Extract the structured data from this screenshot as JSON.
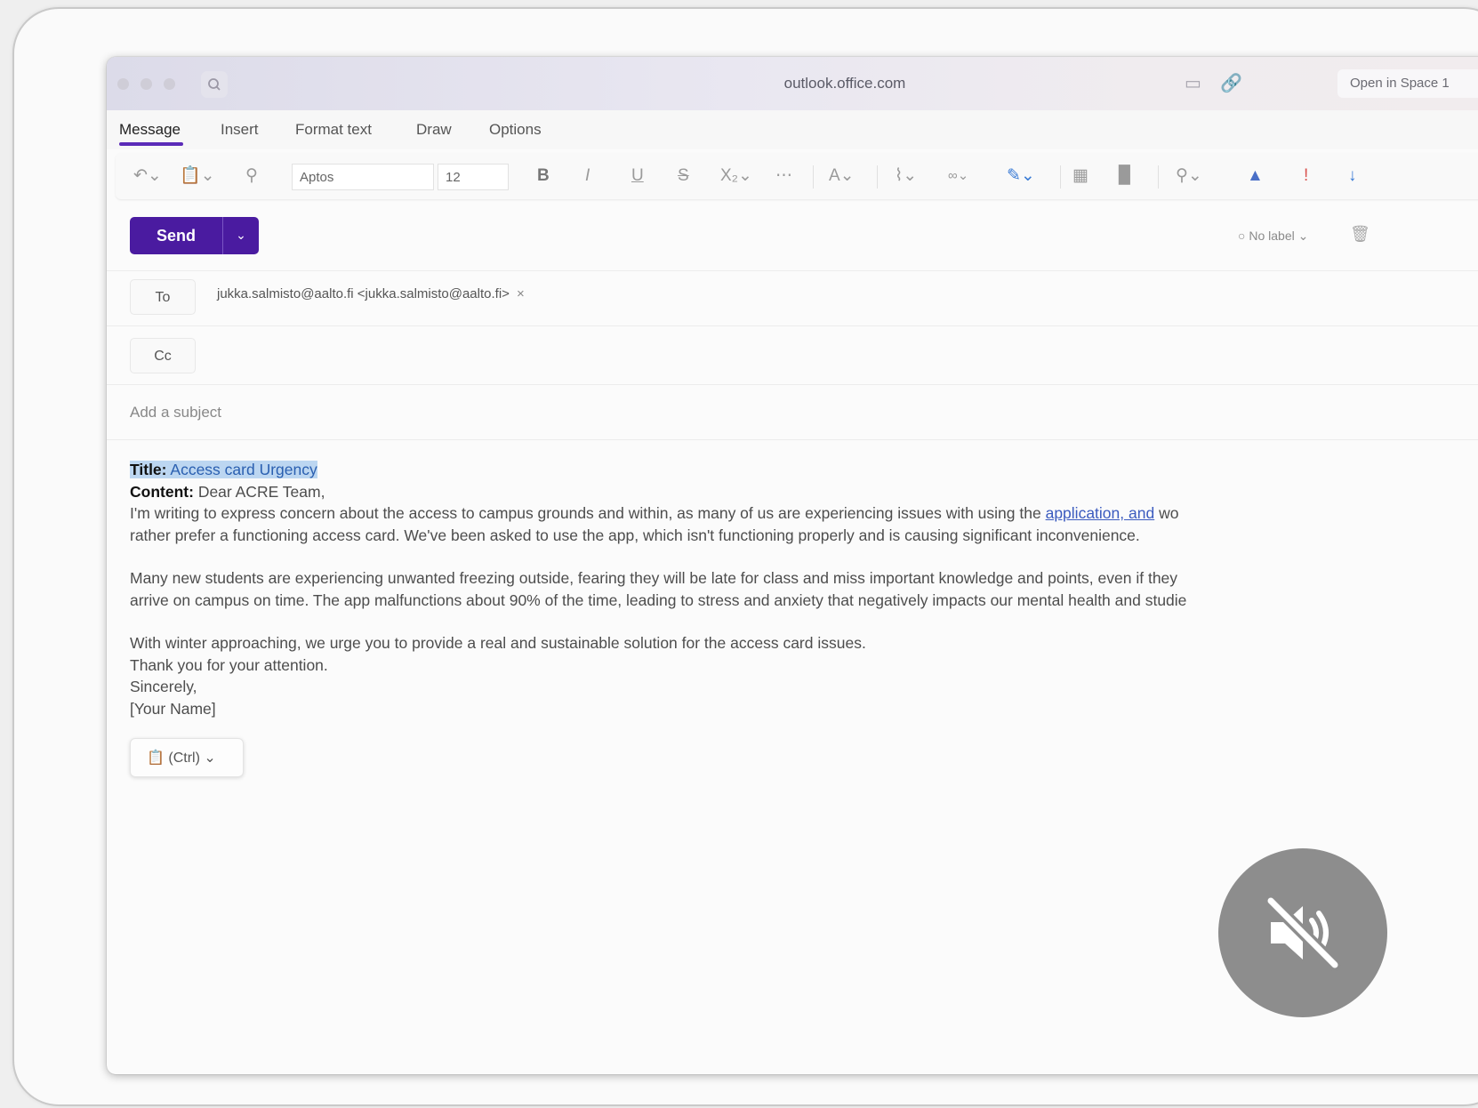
{
  "browser": {
    "url": "outlook.office.com",
    "open_in_space": "Open in Space 1"
  },
  "ribbon": {
    "tabs": [
      "Message",
      "Insert",
      "Format text",
      "Draw",
      "Options"
    ],
    "active_tab": "Message",
    "font_name": "Aptos",
    "font_size": "12",
    "accent_color": "#5b2bb8"
  },
  "compose": {
    "send_label": "Send",
    "send_color": "#4a1ba0",
    "no_label": "No label",
    "to_label": "To",
    "cc_label": "Cc",
    "recipient": "jukka.salmisto@aalto.fi <jukka.salmisto@aalto.fi>",
    "subject_placeholder": "Add a subject",
    "body": {
      "title_label": "Title:",
      "title_value": "Access card Urgency",
      "content_label": "Content:",
      "greeting": "Dear ACRE Team,",
      "p1_line1_before": "I'm writing to express concern about the access to campus grounds and within, as many of us are experiencing issues with using the",
      "p1_link": "application, and",
      "p1_line1_after": "wo",
      "p1_line2": "rather prefer a functioning access card. We've been asked to use the app, which isn't functioning properly and is causing significant inconvenience.",
      "p2_line1": "Many new students are experiencing unwanted freezing outside, fearing they will be late for class and miss important knowledge and points, even if they",
      "p2_line2": "arrive on campus on time. The app malfunctions about 90% of the time, leading to stress and anxiety that negatively impacts our mental health and studie",
      "p3": "With winter approaching, we urge you to provide a real and sustainable solution for the access card issues.",
      "thanks": "Thank you for your attention.",
      "closing": "Sincerely,",
      "signature": "[Your Name]"
    },
    "paste_options_label": "(Ctrl)"
  },
  "overlay": {
    "icon": "muted-speaker-icon"
  }
}
